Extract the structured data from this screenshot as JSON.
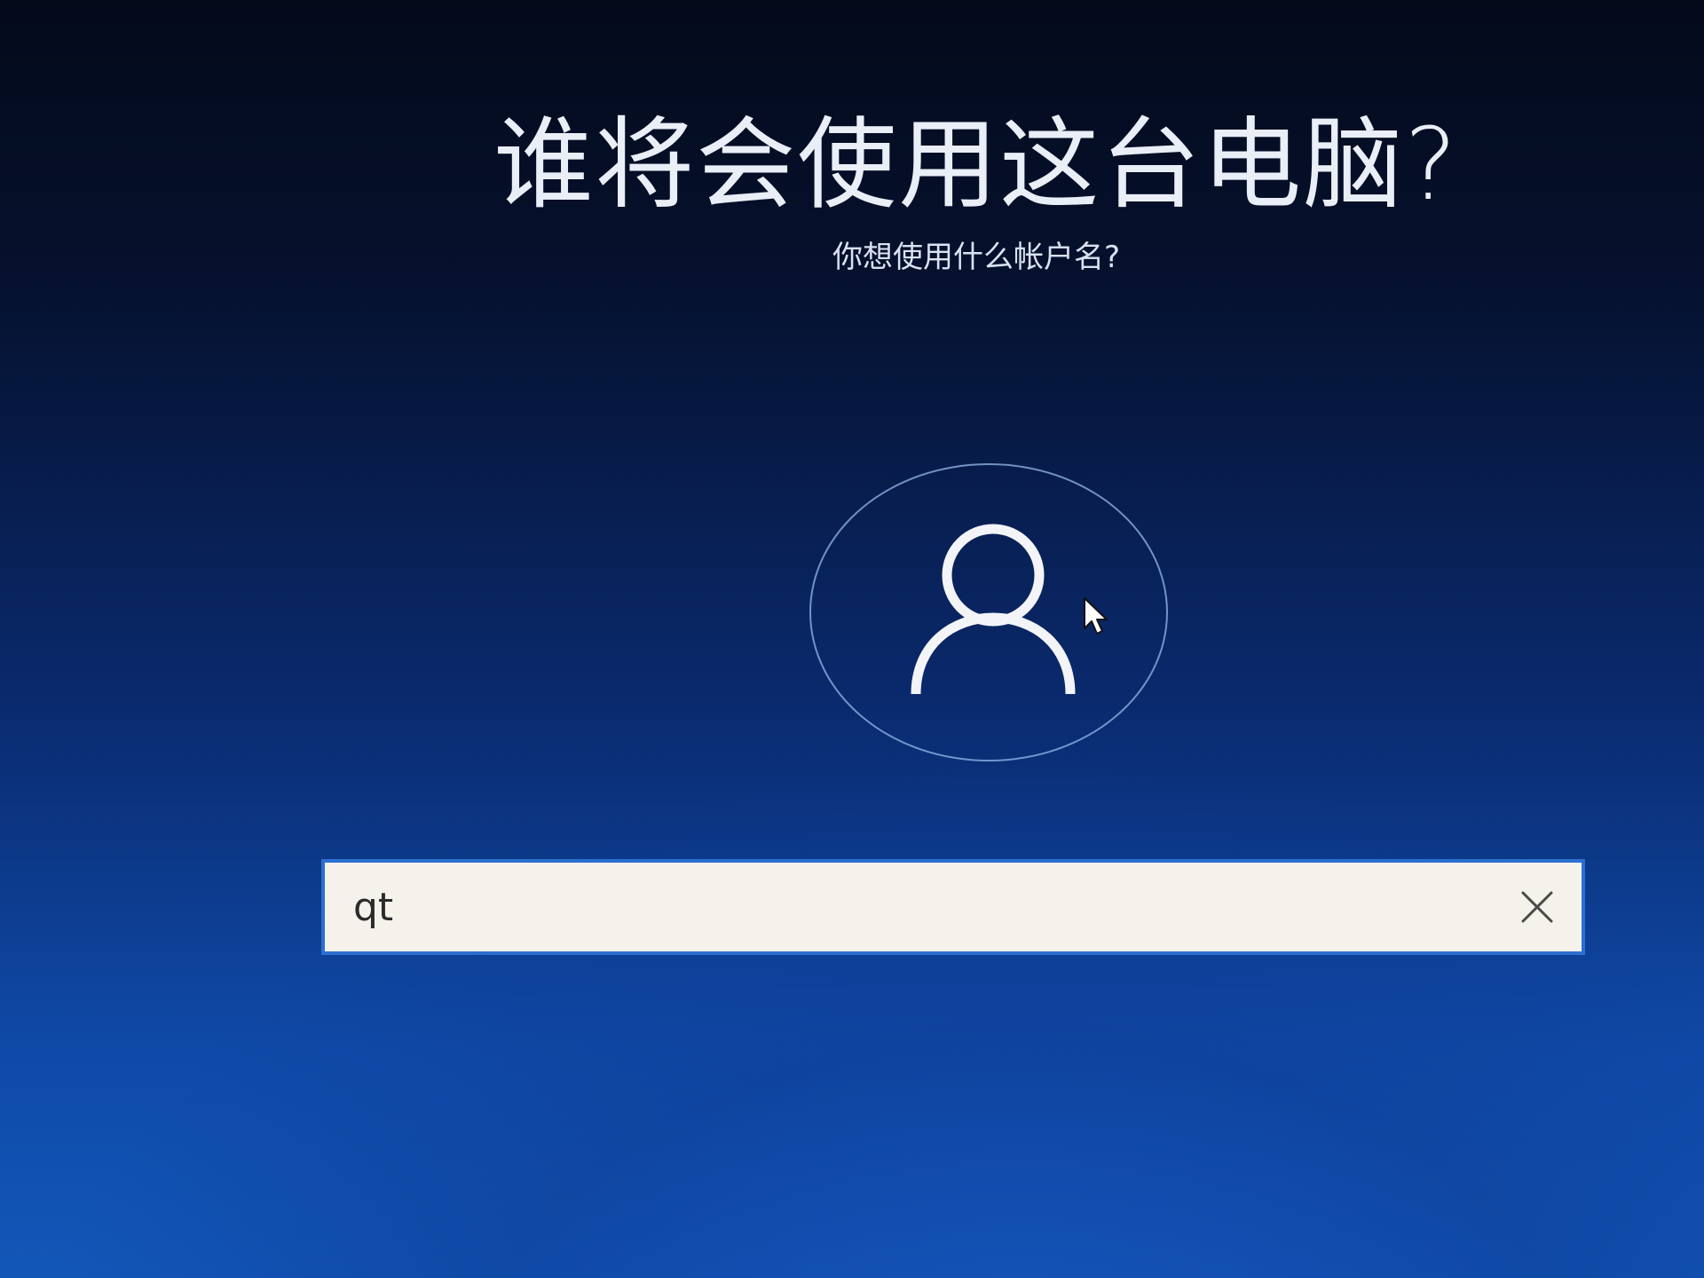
{
  "header": {
    "title": "谁将会使用这台电脑?",
    "subtitle": "你想使用什么帐户名?"
  },
  "avatar": {
    "icon": "user-icon"
  },
  "name_field": {
    "value": "qt",
    "clear_icon": "close-icon"
  },
  "pointer": {
    "icon": "mouse-cursor-icon"
  },
  "colors": {
    "background_top": "#040a1a",
    "background_bottom": "#1257b8",
    "field_border": "#2c6fd0",
    "field_background": "#f4f2ea"
  }
}
